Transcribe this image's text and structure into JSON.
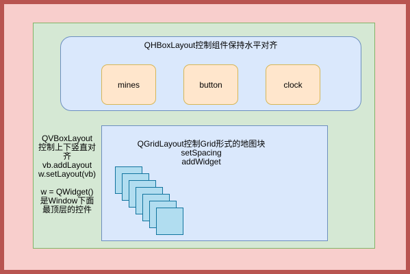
{
  "hbox": {
    "title": "QHBoxLayout控制组件保持水平对齐",
    "widgets": [
      "mines",
      "button",
      "clock"
    ]
  },
  "grid": {
    "line1": "QGridLayout控制Grid形式的地图块",
    "line2": "setSpacing",
    "line3": "addWidget",
    "tile_count": 7
  },
  "vbox_note": {
    "line1": "QVBoxLayout",
    "line2": "控制上下竖直对",
    "line3": "齐",
    "line4": "vb.addLayout",
    "line5": "w.setLayout(vb)",
    "line6": "w = QWidget()",
    "line7": "是Window下面",
    "line8": "最顶层的控件"
  },
  "colors": {
    "outer_fill": "#f8cecc",
    "outer_stroke": "#b85450",
    "window_fill": "#d5e8d4",
    "window_stroke": "#82b366",
    "layout_fill": "#dae8fc",
    "layout_stroke": "#6c8ebf",
    "widget_fill": "#ffe6cc",
    "widget_stroke": "#d6b656",
    "tile_fill": "#b1ddf0",
    "tile_stroke": "#10739e"
  }
}
